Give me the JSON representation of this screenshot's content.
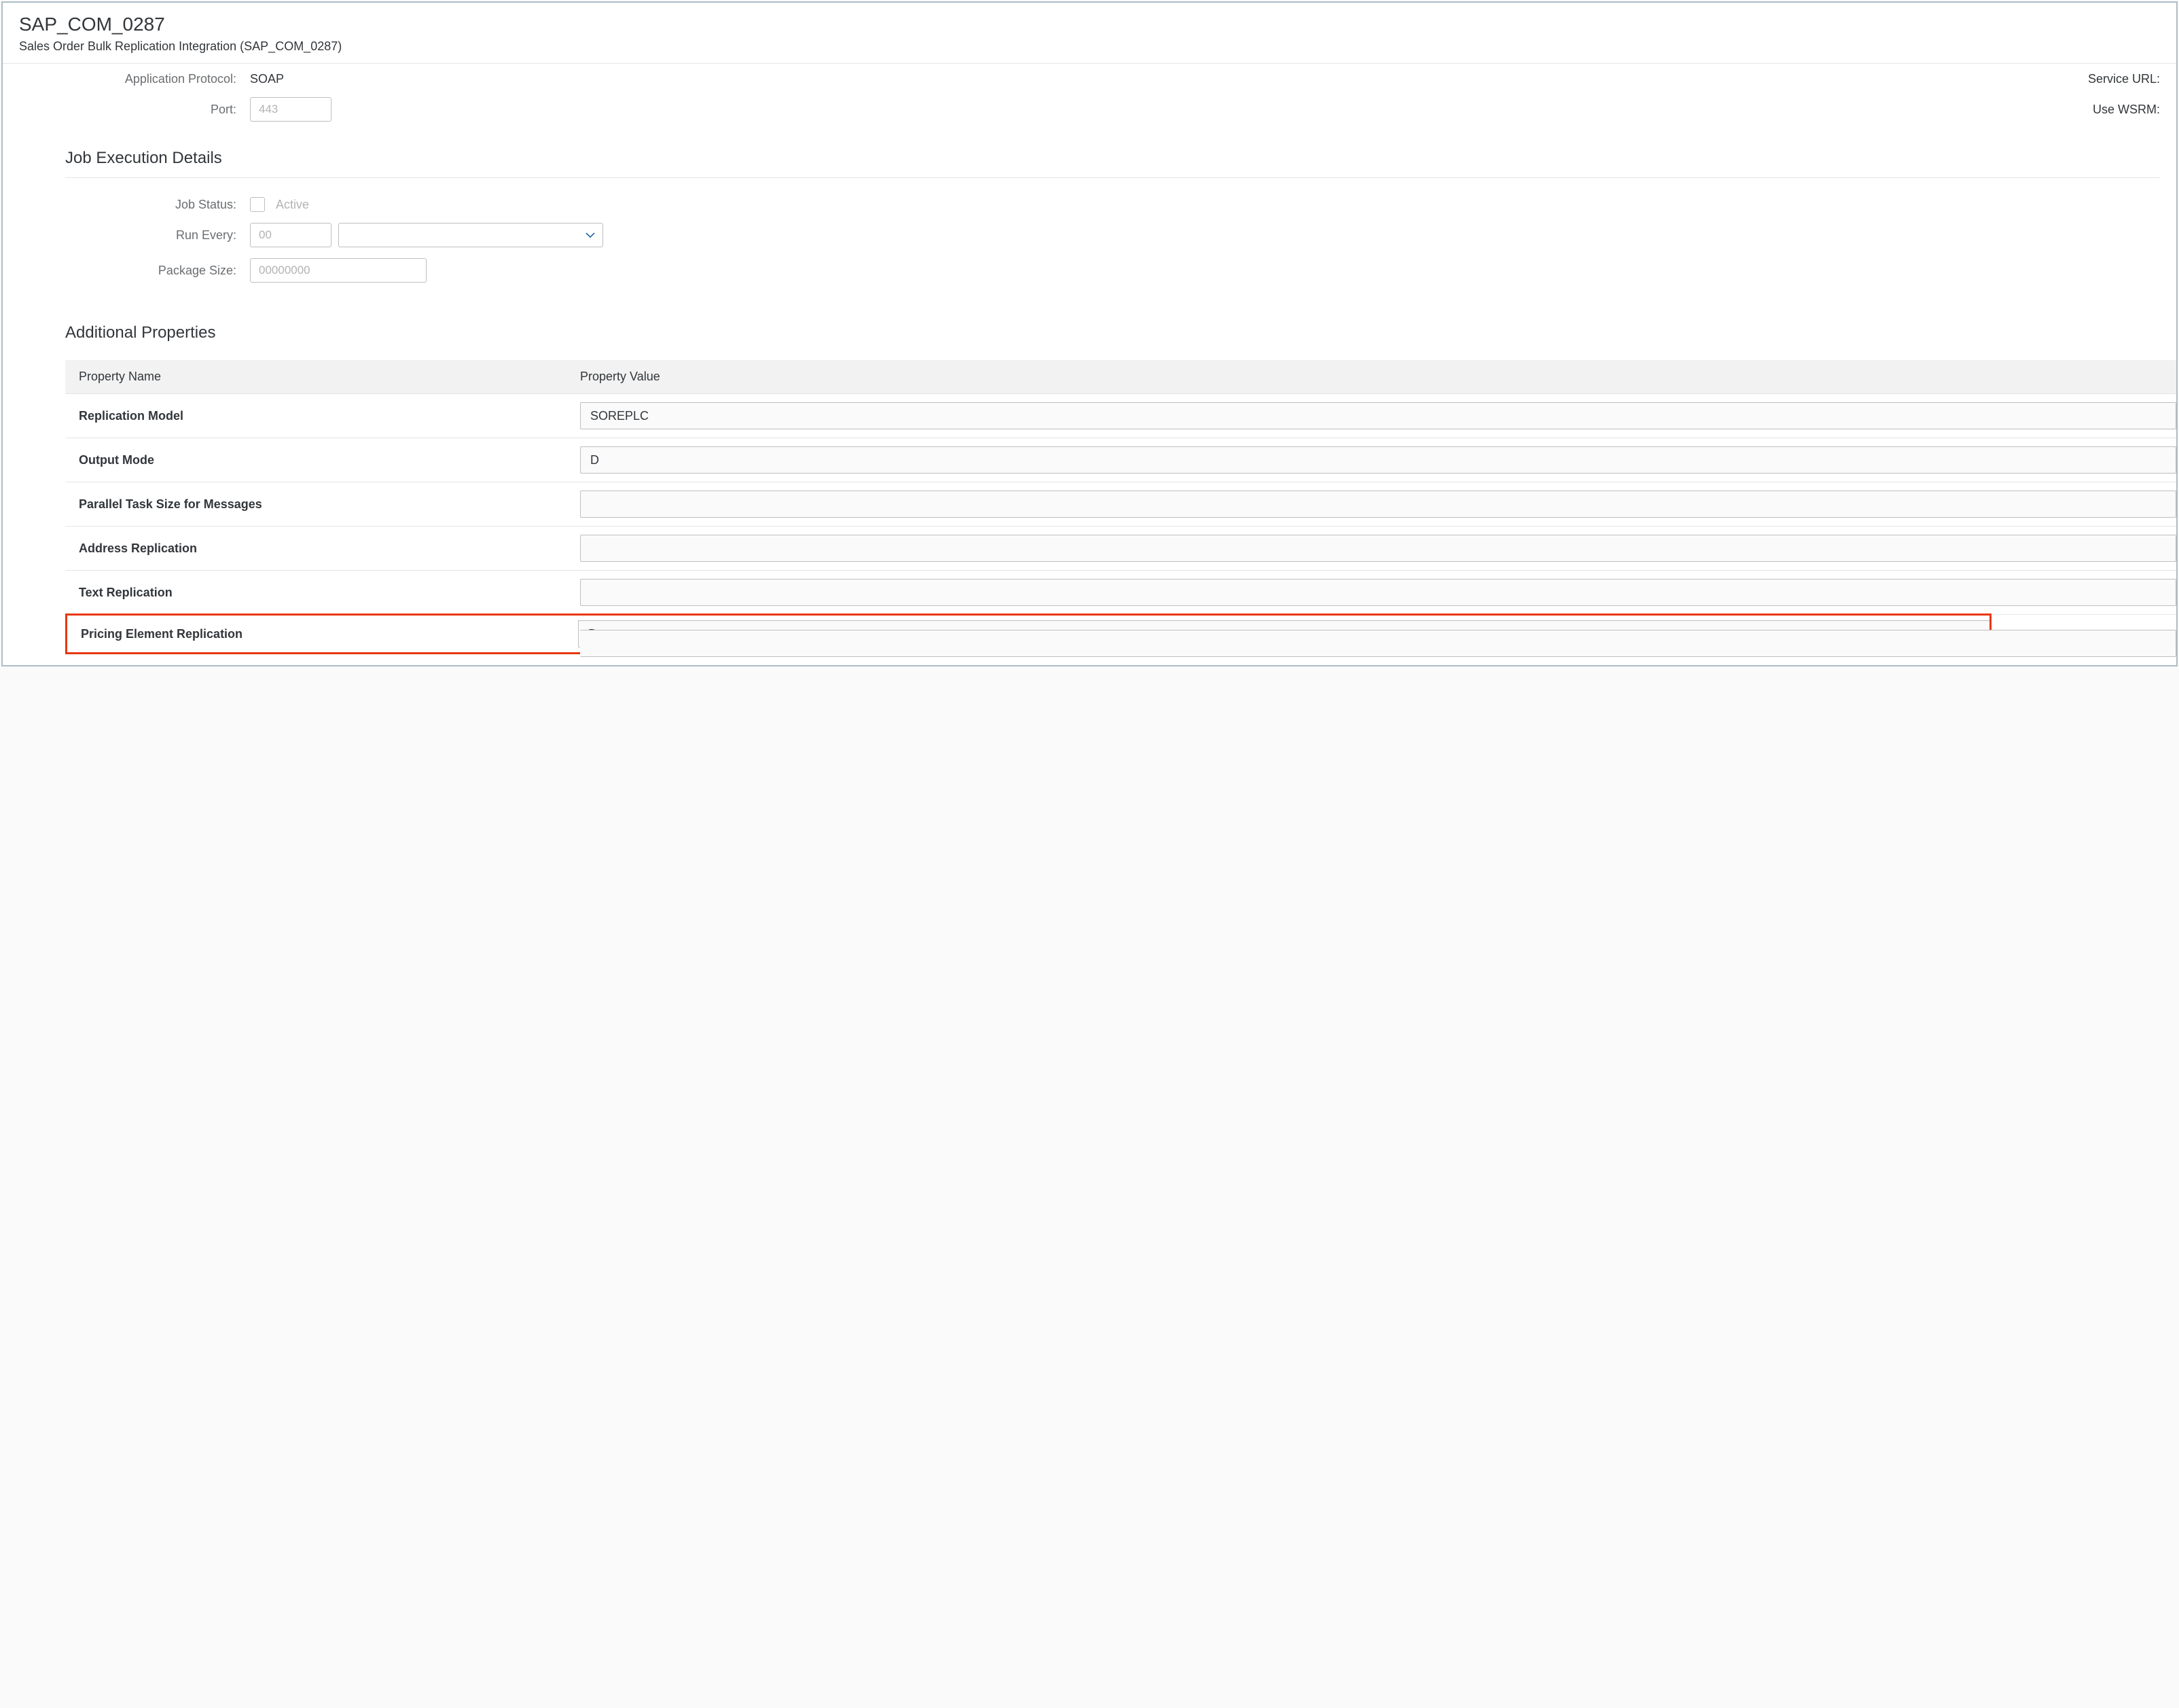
{
  "header": {
    "title": "SAP_COM_0287",
    "subtitle": "Sales Order Bulk Replication Integration (SAP_COM_0287)"
  },
  "connectionDetails": {
    "appProtocolLabel": "Application Protocol:",
    "appProtocolValue": "SOAP",
    "serviceUrlLabel": "Service URL:",
    "portLabel": "Port:",
    "portPlaceholder": "443",
    "useWsrmLabel": "Use WSRM:"
  },
  "jobExecution": {
    "title": "Job Execution Details",
    "jobStatusLabel": "Job Status:",
    "jobStatusValue": "Active",
    "runEveryLabel": "Run Every:",
    "runEveryPlaceholder": "00",
    "packageSizeLabel": "Package Size:",
    "packageSizePlaceholder": "00000000"
  },
  "additionalProperties": {
    "title": "Additional Properties",
    "columns": {
      "name": "Property Name",
      "value": "Property Value"
    },
    "rows": [
      {
        "name": "Replication Model",
        "value": "SOREPLC"
      },
      {
        "name": "Output Mode",
        "value": "D"
      },
      {
        "name": "Parallel Task Size for Messages",
        "value": ""
      },
      {
        "name": "Address Replication",
        "value": ""
      },
      {
        "name": "Text Replication",
        "value": ""
      },
      {
        "name": "Pricing Element Replication",
        "value": "B"
      }
    ]
  }
}
